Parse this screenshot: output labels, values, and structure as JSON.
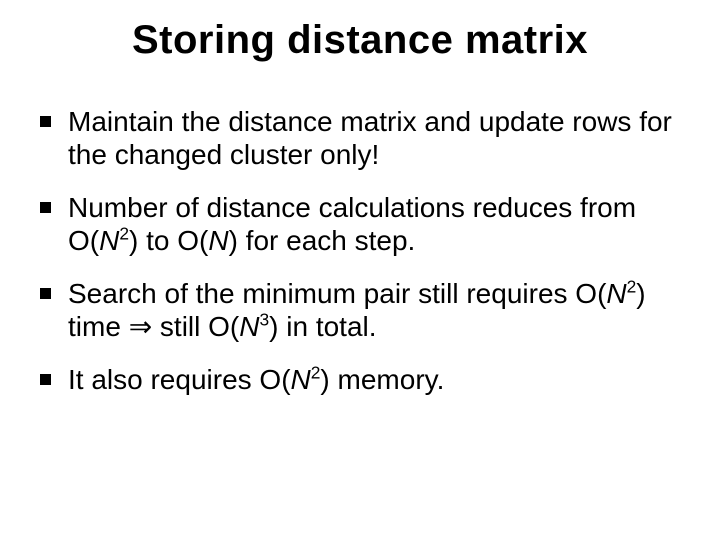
{
  "title": "Storing distance matrix",
  "bullets": {
    "b1": {
      "text": "Maintain the distance matrix and update rows for the changed cluster only!"
    },
    "b2": {
      "pre": "Number of distance calculations reduces from O(",
      "n1": "N",
      "sup1": "2",
      "mid": ") to O(",
      "n2": "N",
      "post": ") for each step."
    },
    "b3": {
      "pre": "Search of the minimum pair still requires O(",
      "n1": "N",
      "sup1": "2",
      "mid1": ") time ",
      "arrow": "⇒",
      "mid2": " still O(",
      "n2": "N",
      "sup2": "3",
      "post": ") in total."
    },
    "b4": {
      "pre": "It also requires O(",
      "n1": "N",
      "sup1": "2",
      "post": ") memory."
    }
  }
}
